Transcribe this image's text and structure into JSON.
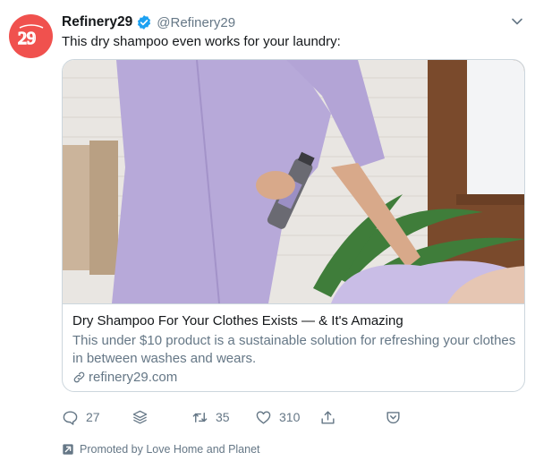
{
  "colors": {
    "brand": "#f0514e",
    "verified": "#1da1f2",
    "muted": "#657786",
    "text": "#14171a"
  },
  "tweet": {
    "avatar_icon": "refinery29-logo",
    "display_name": "Refinery29",
    "handle": "@Refinery29",
    "text": "This dry shampoo even works for your laundry:"
  },
  "card": {
    "image": "woman-spraying-dry-shampoo-on-clothes",
    "title": "Dry Shampoo For Your Clothes Exists — & It's Amazing",
    "description": "This under $10 product is a sustainable solution for refreshing your clothes in between washes and wears.",
    "domain": "refinery29.com"
  },
  "actions": {
    "reply_count": "27",
    "retweet_count": "35",
    "like_count": "310"
  },
  "promoted": {
    "label": "Promoted by Love Home and Planet"
  }
}
